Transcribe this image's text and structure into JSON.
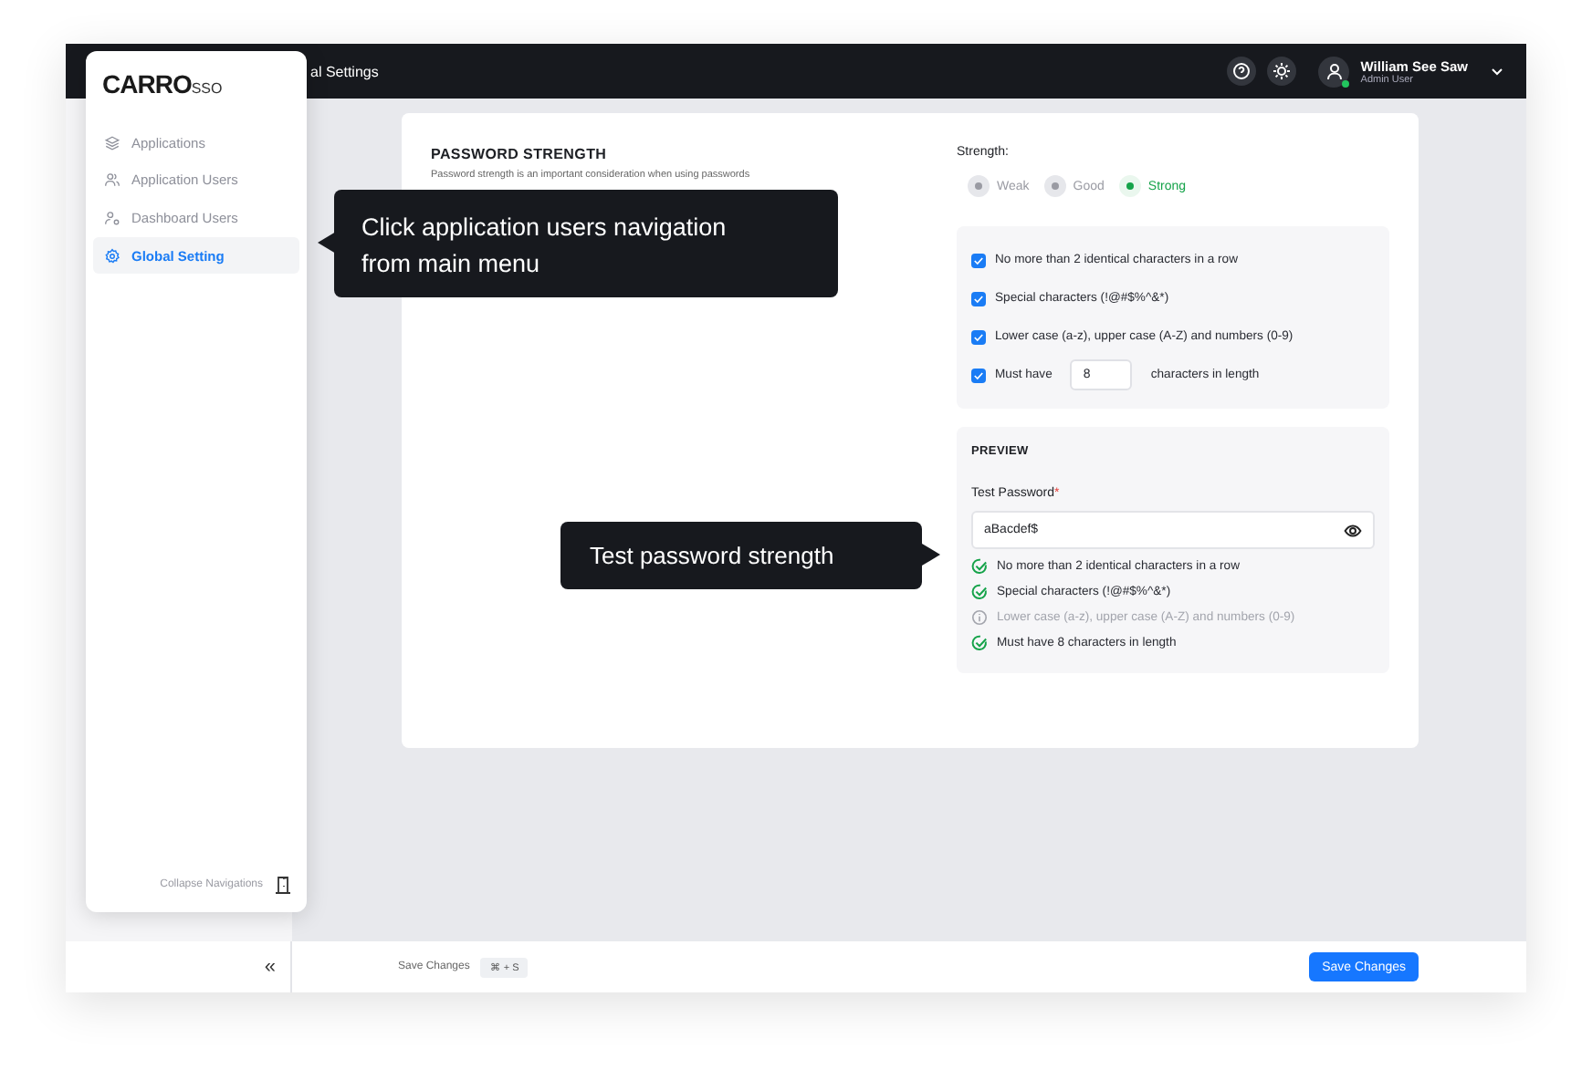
{
  "top_bar": {
    "breadcrumb": "al Settings",
    "user": {
      "name": "William See Saw",
      "role": "Admin User",
      "online": true
    }
  },
  "nav_menu": {
    "logo": "CARRO",
    "logo_suffix": "SSO",
    "items": [
      {
        "label": "Applications",
        "selected": false
      },
      {
        "label": "Application Users",
        "selected": false
      },
      {
        "label": "Dashboard Users",
        "selected": false
      },
      {
        "label": "Global Setting",
        "selected": true
      }
    ],
    "collapse_label": "Collapse Navigations"
  },
  "password_strength": {
    "title": "PASSWORD STRENGTH",
    "description": "Password strength is an important consideration when using passwords",
    "strength_label": "Strength:",
    "levels": [
      {
        "label": "Weak",
        "selected": false
      },
      {
        "label": "Good",
        "selected": false
      },
      {
        "label": "Strong",
        "selected": true
      }
    ],
    "rules": [
      {
        "kind": "text",
        "label": "No more than 2 identical characters in a row",
        "checked": true
      },
      {
        "kind": "text",
        "label": "Special characters (!@#$%^&*)",
        "checked": true
      },
      {
        "kind": "text",
        "label": "Lower case (a-z), upper case (A-Z) and numbers (0-9)",
        "checked": true
      },
      {
        "kind": "length",
        "label": "Must have",
        "value": "8",
        "suffix": "characters in length",
        "checked": true
      }
    ],
    "preview": {
      "title": "PREVIEW",
      "field_label": "Test Password",
      "required": true,
      "required_mark": "*",
      "value": "aBacdef$",
      "results": [
        {
          "label": "No more than 2 identical characters in a row",
          "passed": true
        },
        {
          "label": "Special characters (!@#$%^&*)",
          "passed": true
        },
        {
          "label": "Lower case (a-z), upper case (A-Z) and numbers (0-9)",
          "passed": false
        },
        {
          "label": "Must have 8 characters in length",
          "passed": true
        }
      ]
    }
  },
  "tooltips": [
    "Click application users navigation from main menu",
    "Test password strength"
  ],
  "footer": {
    "collapse_glyph": "«",
    "hint": "Save Changes",
    "shortcut": "⌘ + S",
    "save_button": "Save Changes"
  }
}
